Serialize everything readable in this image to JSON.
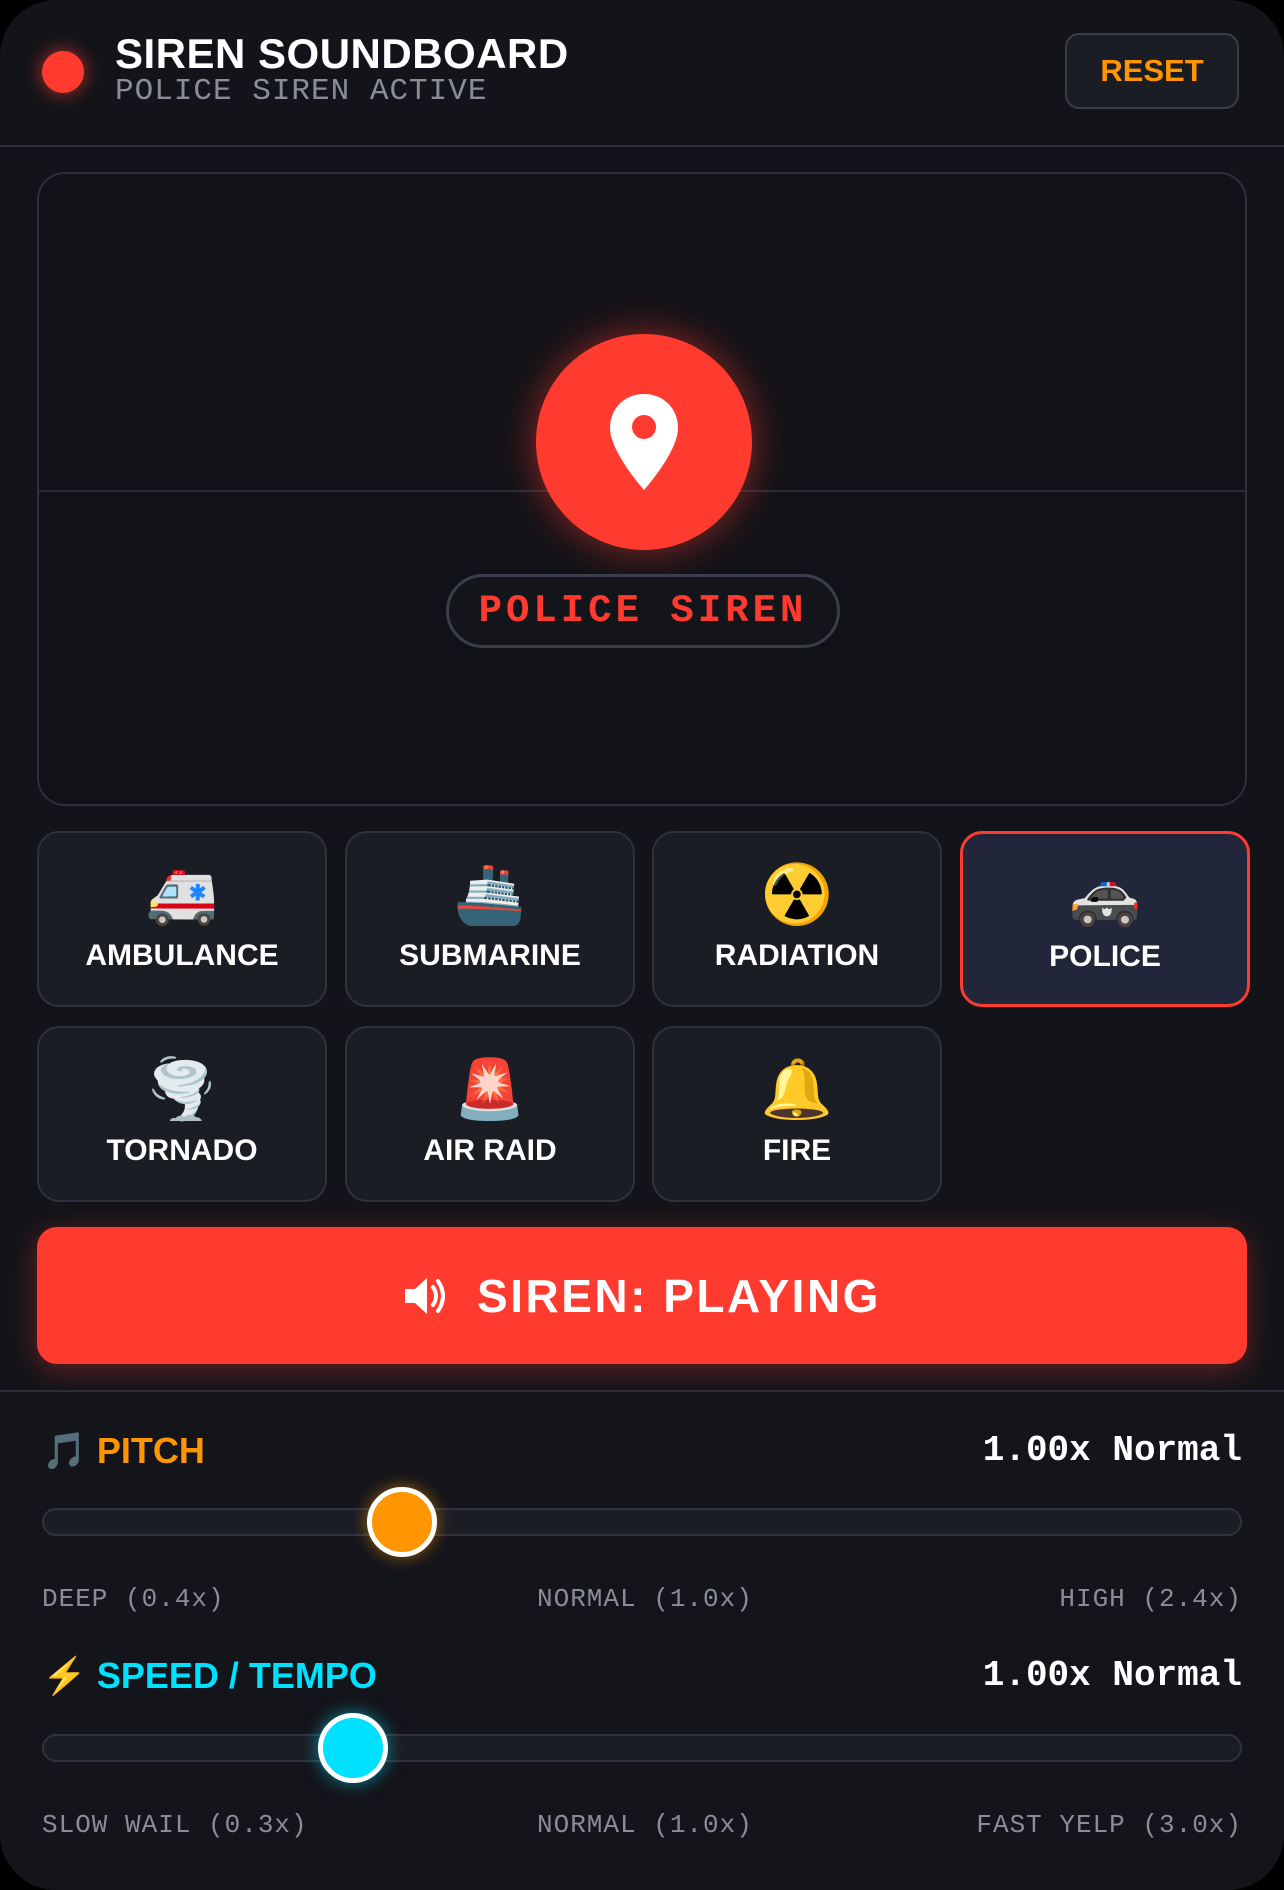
{
  "header": {
    "title": "SIREN SOUNDBOARD",
    "subtitle": "POLICE SIREN ACTIVE",
    "reset_label": "RESET"
  },
  "visual": {
    "icon": "map-pin-icon",
    "label": "POLICE SIREN"
  },
  "sirens": [
    {
      "emoji": "🚑",
      "label": "AMBULANCE",
      "active": false
    },
    {
      "emoji": "🚢",
      "label": "SUBMARINE",
      "active": false
    },
    {
      "emoji": "☢️",
      "label": "RADIATION",
      "active": false
    },
    {
      "emoji": "🚓",
      "label": "POLICE",
      "active": true
    },
    {
      "emoji": "🌪️",
      "label": "TORNADO",
      "active": false
    },
    {
      "emoji": "🚨",
      "label": "AIR RAID",
      "active": false
    },
    {
      "emoji": "🔔",
      "label": "FIRE",
      "active": false
    }
  ],
  "play_button": {
    "icon": "speaker-icon",
    "label": "SIREN: PLAYING"
  },
  "pitch": {
    "icon": "🎵",
    "title": "PITCH",
    "value": "1.00x Normal",
    "min_label": "DEEP (0.4x)",
    "mid_label": "NORMAL (1.0x)",
    "max_label": "HIGH (2.4x)",
    "level": 1.0,
    "min": 0.4,
    "max": 2.4,
    "color": "#ff9500"
  },
  "speed": {
    "icon": "⚡",
    "title": "SPEED / TEMPO",
    "value": "1.00x Normal",
    "min_label": "SLOW WAIL (0.3x)",
    "mid_label": "NORMAL (1.0x)",
    "max_label": "FAST YELP (3.0x)",
    "level": 1.0,
    "min": 0.3,
    "max": 3.0,
    "color": "#00e0ff"
  },
  "colors": {
    "accent": "#ff3b30",
    "background": "#131419"
  }
}
